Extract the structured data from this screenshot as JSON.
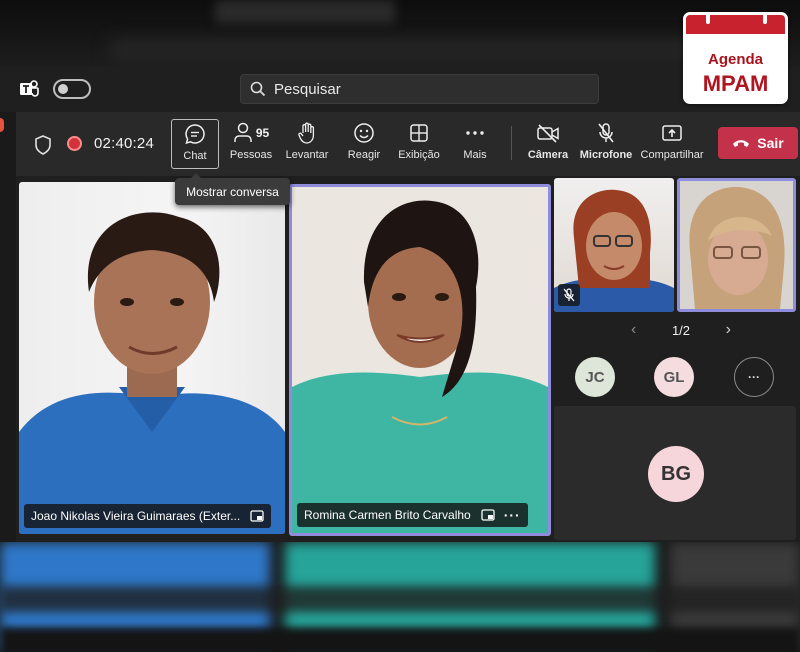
{
  "search": {
    "placeholder": "Pesquisar"
  },
  "meeting": {
    "timer": "02:40:24"
  },
  "toolbar": {
    "chat_label": "Chat",
    "people_label": "Pessoas",
    "people_count": "95",
    "raise_label": "Levantar",
    "react_label": "Reagir",
    "view_label": "Exibição",
    "more_label": "Mais",
    "camera_label": "Câmera",
    "mic_label": "Microfone",
    "share_label": "Compartilhar",
    "leave_label": "Sair"
  },
  "tooltip": {
    "text": "Mostrar conversa"
  },
  "participants": {
    "tile1_name": "Joao Nikolas Vieira Guimaraes (Exter...",
    "tile2_name": "Romina Carmen Brito Carvalho"
  },
  "pager": {
    "text": "1/2"
  },
  "avatars": {
    "jc": "JC",
    "gl": "GL",
    "more": "···",
    "bg": "BG"
  },
  "badge": {
    "line1": "Agenda",
    "line2": "MPAM"
  },
  "colors": {
    "leave": "#c4314b",
    "active_speaker": "#8f8cdc",
    "recording": "#d13438"
  }
}
